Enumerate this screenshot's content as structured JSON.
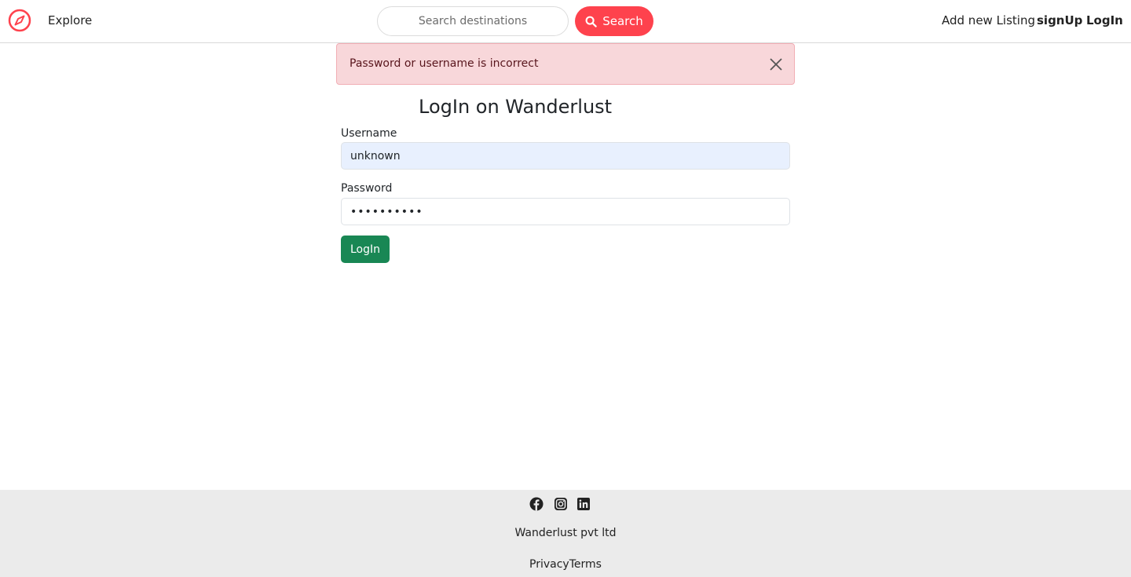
{
  "navbar": {
    "brand_icon": "compass-icon",
    "brand_color": "#fe424d",
    "explore_label": "Explore",
    "search_placeholder": "Search destinations",
    "search_button_label": "Search",
    "search_icon": "search-icon",
    "add_listing_label": "Add new Listing",
    "signup_label": "signUp",
    "login_label": "LogIn"
  },
  "alert": {
    "message": "Password or username is incorrect",
    "close_icon": "close-icon",
    "background": "#f8d7da"
  },
  "login_form": {
    "title": "LogIn on Wanderlust",
    "username_label": "Username",
    "username_value": "unknown",
    "password_label": "Password",
    "password_value": "••••••••••",
    "submit_label": "LogIn",
    "submit_color": "#198754"
  },
  "footer": {
    "social_icons": [
      "facebook-icon",
      "instagram-icon",
      "linkedin-icon"
    ],
    "company": "Wanderlust pvt ltd",
    "privacy_label": "Privacy",
    "terms_label": "Terms"
  }
}
